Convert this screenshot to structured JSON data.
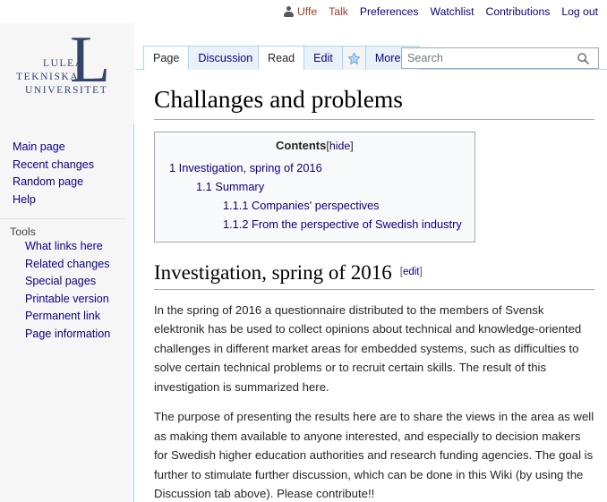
{
  "personal_bar": {
    "user_icon": "user-icon",
    "items": [
      {
        "label": "Uffe",
        "name": "personal-link-username",
        "style": "visited"
      },
      {
        "label": "Talk",
        "name": "personal-link-talk",
        "style": "visited"
      },
      {
        "label": "Preferences",
        "name": "personal-link-preferences",
        "style": "link"
      },
      {
        "label": "Watchlist",
        "name": "personal-link-watchlist",
        "style": "link"
      },
      {
        "label": "Contributions",
        "name": "personal-link-contributions",
        "style": "link"
      },
      {
        "label": "Log out",
        "name": "personal-link-logout",
        "style": "link"
      }
    ]
  },
  "logo": {
    "mark": "L",
    "line1": "LULEÅ",
    "line2": "TEKNISKA",
    "line3": "UNIVERSITET"
  },
  "sidebar": {
    "navigation": [
      {
        "label": "Main page",
        "name": "sidebar-item-main-page"
      },
      {
        "label": "Recent changes",
        "name": "sidebar-item-recent-changes"
      },
      {
        "label": "Random page",
        "name": "sidebar-item-random-page"
      },
      {
        "label": "Help",
        "name": "sidebar-item-help"
      }
    ],
    "tools_heading": "Tools",
    "tools": [
      {
        "label": "What links here",
        "name": "sidebar-item-what-links-here"
      },
      {
        "label": "Related changes",
        "name": "sidebar-item-related-changes"
      },
      {
        "label": "Special pages",
        "name": "sidebar-item-special-pages"
      },
      {
        "label": "Printable version",
        "name": "sidebar-item-printable-version"
      },
      {
        "label": "Permanent link",
        "name": "sidebar-item-permanent-link"
      },
      {
        "label": "Page information",
        "name": "sidebar-item-page-information"
      }
    ]
  },
  "tabs": {
    "namespace": [
      {
        "label": "Page",
        "name": "tab-page",
        "selected": true
      },
      {
        "label": "Discussion",
        "name": "tab-discussion",
        "selected": false
      }
    ],
    "actions": [
      {
        "label": "Read",
        "name": "tab-read",
        "selected": true
      },
      {
        "label": "Edit",
        "name": "tab-edit",
        "selected": false
      }
    ],
    "star_icon": "star-icon",
    "more_label": "More",
    "more_icon": "chevron-down-icon"
  },
  "search": {
    "placeholder": "Search",
    "value": "",
    "icon": "search-icon"
  },
  "page": {
    "title": "Challanges and problems"
  },
  "toc": {
    "title": "Contents",
    "toggle": "hide",
    "bracket_open": "[",
    "bracket_close": "]",
    "entries": [
      {
        "text": "1 Investigation, spring of 2016",
        "level": 1
      },
      {
        "text": "1.1 Summary",
        "level": 2
      },
      {
        "text": "1.1.1 Companies' perspectives",
        "level": 3
      },
      {
        "text": "1.1.2 From the perspective of Swedish industry",
        "level": 3
      }
    ]
  },
  "section": {
    "heading": "Investigation, spring of 2016",
    "edit_label": "edit",
    "edit_bracket_open": "[",
    "edit_bracket_close": "]",
    "paragraphs": [
      "In the spring of 2016 a questionnaire distributed to the members of Svensk elektronik has be used to collect opinions about technical and knowledge-oriented challenges in different market areas for embedded systems, such as difficulties to solve certain technical problems or to recruit certain skills. The result of this investigation is summarized here.",
      "The purpose of presenting the results here are to share the views in the area as well as making them available to anyone interested, and especially to decision makers for Swedish higher education authorities and research funding agencies. The goal is further to stimulate further discussion, which can be done in this Wiki (by using the Discussion tab above). Please contribute!!"
    ]
  },
  "colors": {
    "link": "#0b0080",
    "visited_link": "#9b3e29",
    "tab_border": "#a7d7f9",
    "sidebar_bg": "#f6f6f6",
    "toc_bg": "#f8f9fa",
    "logo_blue": "#33456b"
  }
}
